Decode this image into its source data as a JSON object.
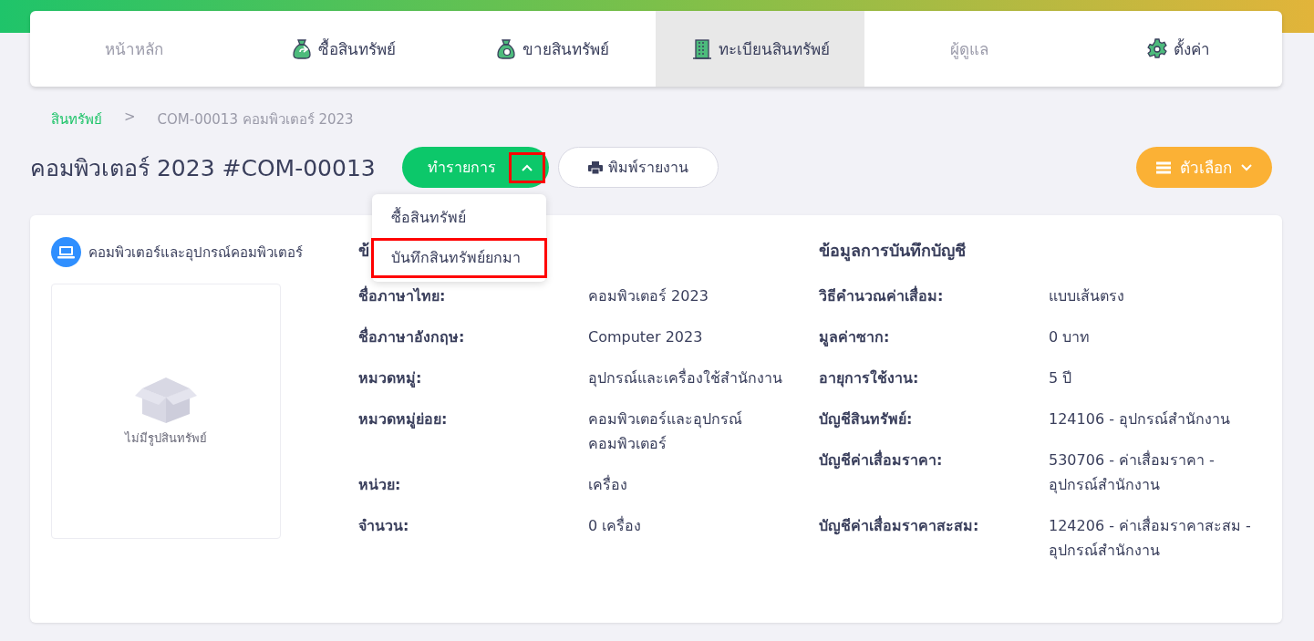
{
  "nav": {
    "tabs": [
      {
        "label": "หน้าหลัก",
        "kind": "plain",
        "selected": false,
        "disabled": true
      },
      {
        "label": "ซื้อสินทรัพย์",
        "kind": "buy",
        "selected": false,
        "disabled": false
      },
      {
        "label": "ขายสินทรัพย์",
        "kind": "sell",
        "selected": false,
        "disabled": false
      },
      {
        "label": "ทะเบียนสินทรัพย์",
        "kind": "register",
        "selected": true,
        "disabled": false
      },
      {
        "label": "ผู้ดูแล",
        "kind": "plain",
        "selected": false,
        "disabled": true
      },
      {
        "label": "ตั้งค่า",
        "kind": "settings",
        "selected": false,
        "disabled": false
      }
    ]
  },
  "breadcrumb": [
    {
      "label": "สินทรัพย์",
      "kind": "link"
    },
    {
      "label": ">",
      "kind": "separator"
    },
    {
      "label": "COM-00013 คอมพิวเตอร์ 2023",
      "kind": "current"
    }
  ],
  "page_title": "คอมพิวเตอร์ 2023 #COM-00013",
  "action_button": {
    "label": "ทำรายการ",
    "expanded": true,
    "toggle_highlighted": true
  },
  "print_button": {
    "label": "พิมพ์รายงาน"
  },
  "options_button": {
    "label": "ตัวเลือก"
  },
  "action_menu": [
    {
      "label": "ซื้อสินทรัพย์",
      "highlighted": false
    },
    {
      "label": "บันทึกสินทรัพย์ยกมา",
      "highlighted": true
    }
  ],
  "category": "คอมพิวเตอร์และอุปกรณ์คอมพิวเตอร์",
  "image_placeholder": "ไม่มีรูปสินทรัพย์",
  "info_section": {
    "title": "ข้",
    "rows": [
      {
        "label": "ชื่อภาษาไทย:",
        "value": "คอมพิวเตอร์ 2023"
      },
      {
        "label": "ชื่อภาษาอังกฤษ:",
        "value": "Computer 2023"
      },
      {
        "label": "หมวดหมู่:",
        "value": "อุปกรณ์และเครื่องใช้สำนักงาน"
      },
      {
        "label": "หมวดหมู่ย่อย:",
        "value": "คอมพิวเตอร์และอุปกรณ์คอมพิวเตอร์"
      },
      {
        "label": "หน่วย:",
        "value": "เครื่อง"
      },
      {
        "label": "จำนวน:",
        "value": "0 เครื่อง"
      }
    ]
  },
  "accounting_section": {
    "title": "ข้อมูลการบันทึกบัญชี",
    "rows": [
      {
        "label": "วิธีคำนวณค่าเสื่อม:",
        "value": "แบบเส้นตรง"
      },
      {
        "label": "มูลค่าซาก:",
        "value": "0 บาท"
      },
      {
        "label": "อายุการใช้งาน:",
        "value": "5 ปี"
      },
      {
        "label": "บัญชีสินทรัพย์:",
        "value": "124106 - อุปกรณ์สำนักงาน"
      },
      {
        "label": "บัญชีค่าเสื่อมราคา:",
        "value": "530706 - ค่าเสื่อมราคา - อุปกรณ์สำนักงาน"
      },
      {
        "label": "บัญชีค่าเสื่อมราคาสะสม:",
        "value": "124206 - ค่าเสื่อมราคาสะสม - อุปกรณ์สำนักงาน"
      }
    ]
  }
}
